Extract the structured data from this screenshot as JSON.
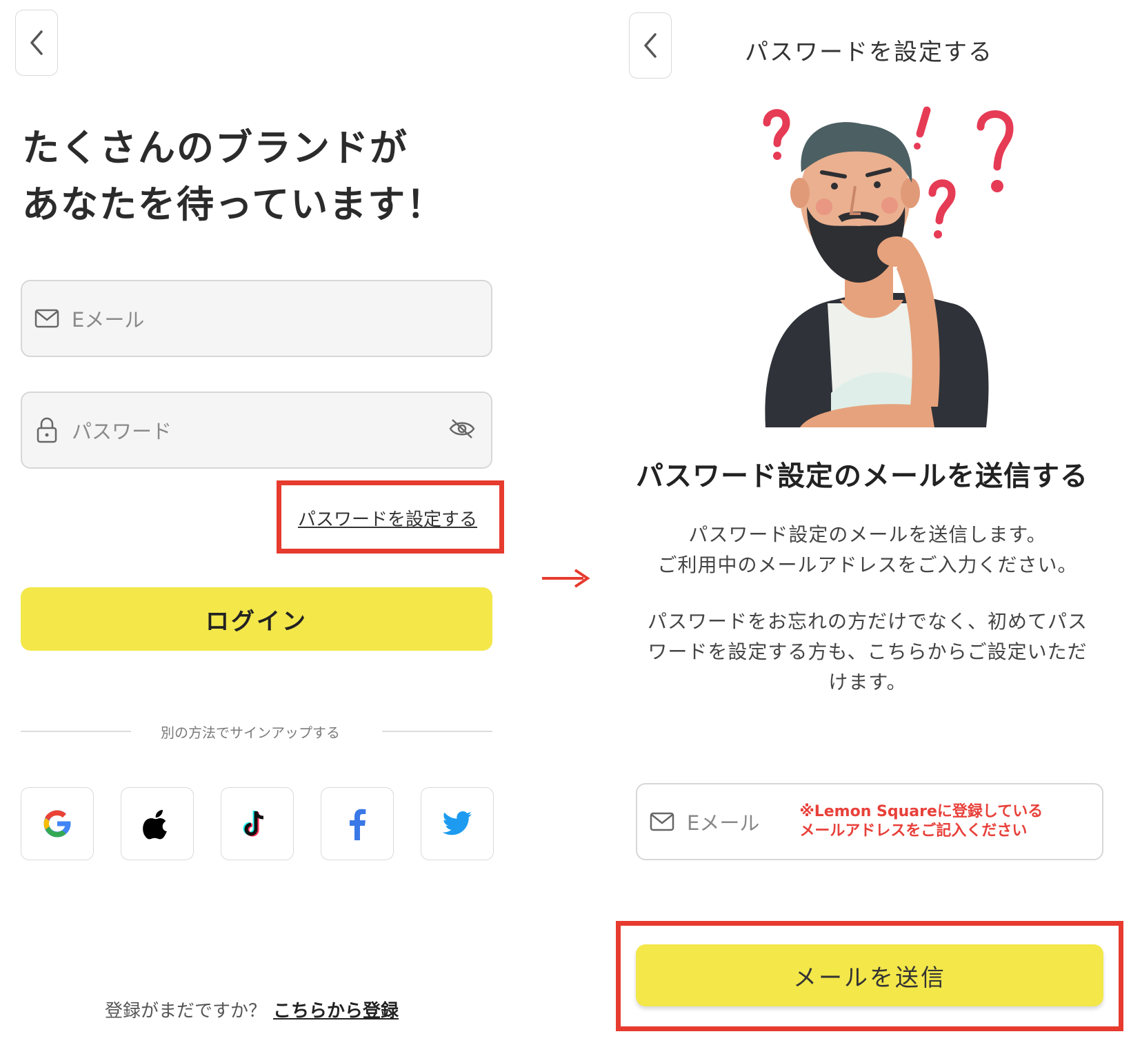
{
  "colors": {
    "accent_yellow": "#f3e74a",
    "annotation_red": "#e63b2e",
    "note_red": "#e8403a"
  },
  "left": {
    "back_icon": "chevron-left-icon",
    "headline_line1": "たくさんのブランドが",
    "headline_line2": "あなたを待っています！",
    "email_placeholder": "Eメール",
    "password_placeholder": "パスワード",
    "set_password_link": "パスワードを設定する",
    "login_button": "ログイン",
    "divider_text": "別の方法でサインアップする",
    "social": [
      "google-icon",
      "apple-icon",
      "tiktok-icon",
      "facebook-icon",
      "twitter-icon"
    ],
    "register_prompt": "登録がまだですか？",
    "register_link": "こちらから登録"
  },
  "right": {
    "back_icon": "chevron-left-icon",
    "title": "パスワードを設定する",
    "heading": "パスワード設定のメールを送信する",
    "desc_line1": "パスワード設定のメールを送信します。",
    "desc_line2": "ご利用中のメールアドレスをご入力ください。",
    "desc_para2": "パスワードをお忘れの方だけでなく、初めてパスワードを設定する方も、こちらからご設定いただけます。",
    "email_placeholder": "Eメール",
    "note_line1": "※Lemon Squareに登録している",
    "note_line2": "メールアドレスをご記入ください",
    "send_button": "メールを送信"
  }
}
